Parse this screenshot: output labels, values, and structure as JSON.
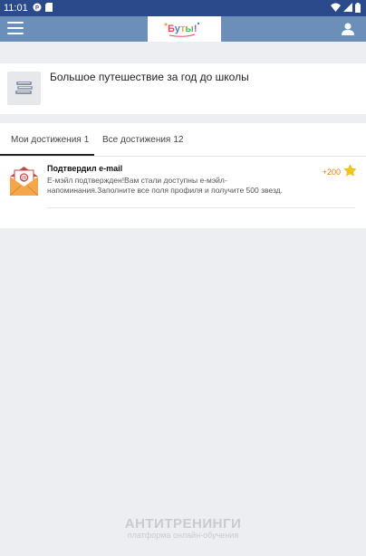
{
  "status_bar": {
    "time": "11:01"
  },
  "app": {
    "logo_text": "Буты!"
  },
  "course": {
    "title": "Большое путешествие за год до школы"
  },
  "tabs": [
    {
      "label": "Мои достижения",
      "count": "1"
    },
    {
      "label": "Все достижения",
      "count": "12"
    }
  ],
  "achievement": {
    "title": "Подтвердил e-mail",
    "description": "E-мэйл подтвержден!Вам стали доступны е-мэйл-напоминания.Заполните все поля профиля и получите 500 звезд.",
    "points": "+200"
  },
  "footer": {
    "brand": "АНТИТРЕНИНГИ",
    "tagline": "платформа онлайн-обучения"
  },
  "colors": {
    "status_bar": "#2b4a8c",
    "app_bar": "#6b8fb8",
    "points": "#e07a1f",
    "star": "#f5c518"
  }
}
